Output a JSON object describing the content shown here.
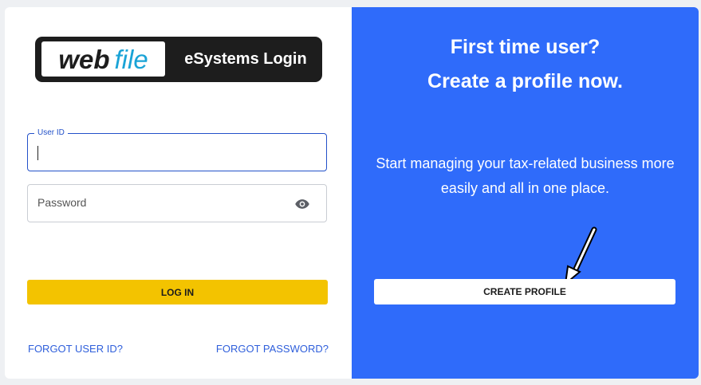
{
  "logo": {
    "brand_bold": "web",
    "brand_light": "file",
    "product": "eSystems Login"
  },
  "login": {
    "userid_label": "User ID",
    "userid_value": "",
    "password_placeholder": "Password",
    "login_button": "LOG IN",
    "forgot_userid": "FORGOT USER ID?",
    "forgot_password": "FORGOT PASSWORD?"
  },
  "signup": {
    "title_line1": "First time user?",
    "title_line2": "Create a profile now.",
    "body": "Start managing your tax-related business more easily and all in one place.",
    "create_button": "CREATE PROFILE"
  },
  "icons": {
    "password_toggle": "eye-icon",
    "pointer": "arrow-pointer-icon"
  },
  "colors": {
    "right_panel_bg": "#2f6bfa",
    "login_button_bg": "#f3c300",
    "link": "#2f5fdb",
    "focus_border": "#2351c9"
  }
}
